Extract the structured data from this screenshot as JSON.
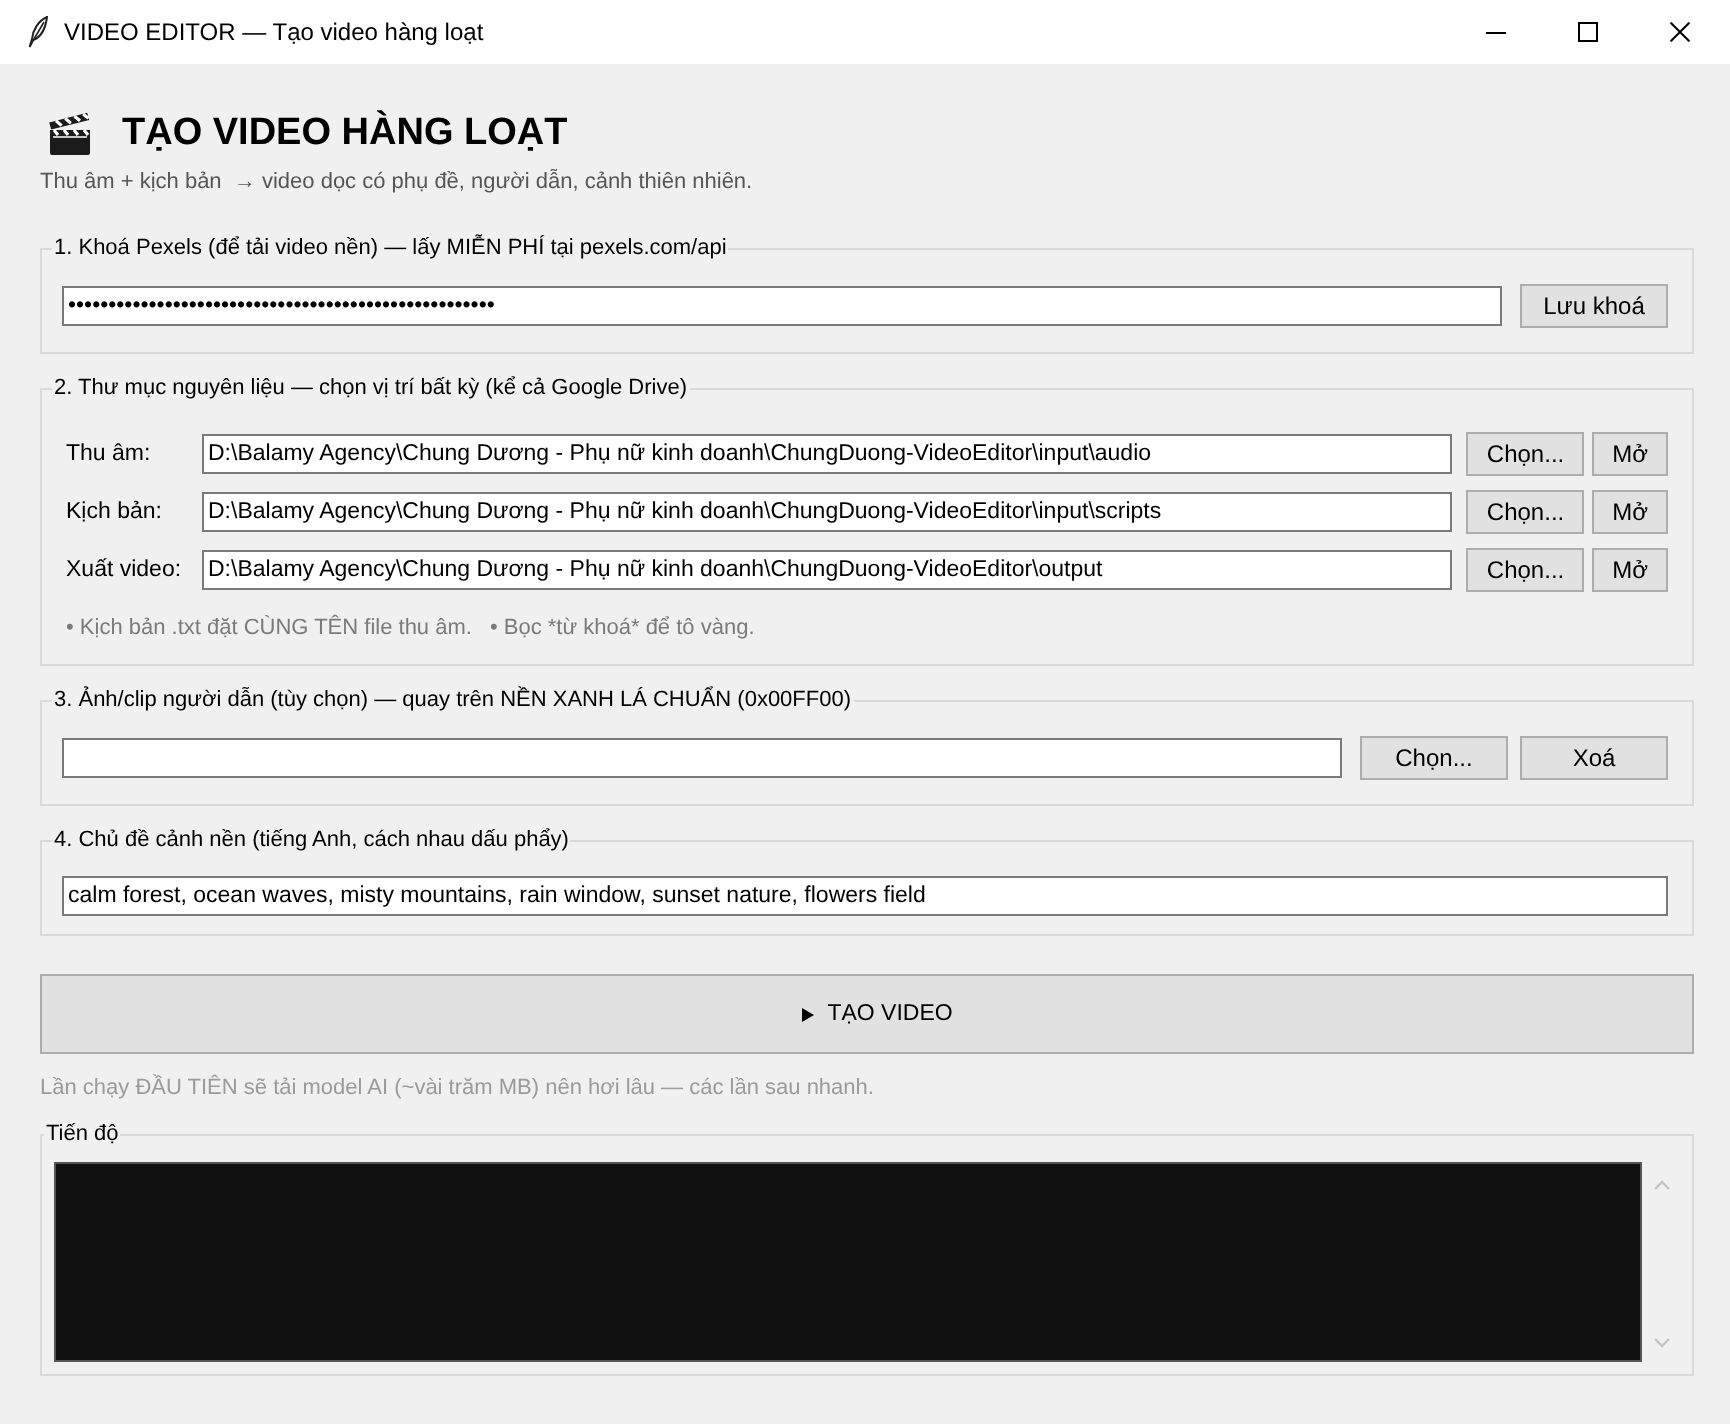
{
  "window": {
    "title": "VIDEO EDITOR — Tạo video hàng loạt"
  },
  "header": {
    "title": "TẠO VIDEO HÀNG LOẠT",
    "subtitle": "Thu âm + kịch bản  → video dọc có phụ đề, người dẫn, cảnh thiên nhiên."
  },
  "sections": [
    {
      "kind": "api_key",
      "label": "1. Khoá Pexels (để tải video nền) — lấy MIỄN PHÍ tại pexels.com/api",
      "value": "•••••••••••••••••••••••••••••••••••••••••••••••••••••",
      "buttons": [
        "Lưu khoá"
      ]
    },
    {
      "kind": "folders",
      "label": "2. Thư mục nguyên liệu — chọn vị trí bất kỳ (kể cả Google Drive)",
      "rows": [
        {
          "label": "Thu âm:",
          "value": "D:\\Balamy Agency\\Chung Dương - Phụ nữ kinh doanh\\ChungDuong-VideoEditor\\input\\audio",
          "buttons": [
            "Chọn...",
            "Mở"
          ]
        },
        {
          "label": "Kịch bản:",
          "value": "D:\\Balamy Agency\\Chung Dương - Phụ nữ kinh doanh\\ChungDuong-VideoEditor\\input\\scripts",
          "buttons": [
            "Chọn...",
            "Mở"
          ]
        },
        {
          "label": "Xuất video:",
          "value": "D:\\Balamy Agency\\Chung Dương - Phụ nữ kinh doanh\\ChungDuong-VideoEditor\\output",
          "buttons": [
            "Chọn...",
            "Mở"
          ]
        }
      ],
      "notes": [
        "• Kịch bản .txt đặt CÙNG TÊN file thu âm.",
        "• Bọc *từ khoá* để tô vàng."
      ]
    },
    {
      "kind": "file",
      "label": "3. Ảnh/clip người dẫn (tùy chọn) — quay trên NỀN XANH LÁ CHUẨN (0x00FF00)",
      "buttons": [
        "Chọn...",
        "Xoá"
      ]
    },
    {
      "kind": "text",
      "label": "4. Chủ đề cảnh nền (tiếng Anh, cách nhau dấu phẩy)",
      "value": "calm forest, ocean waves, misty mountains, rain window, sunset nature, flowers field"
    }
  ],
  "run_button": {
    "label": "TẠO VIDEO"
  },
  "hint": "Lần chạy ĐẦU TIÊN sẽ tải model AI (~vài trăm MB) nên hơi lâu — các lần sau nhanh.",
  "progress": {
    "label": "Tiến độ"
  }
}
